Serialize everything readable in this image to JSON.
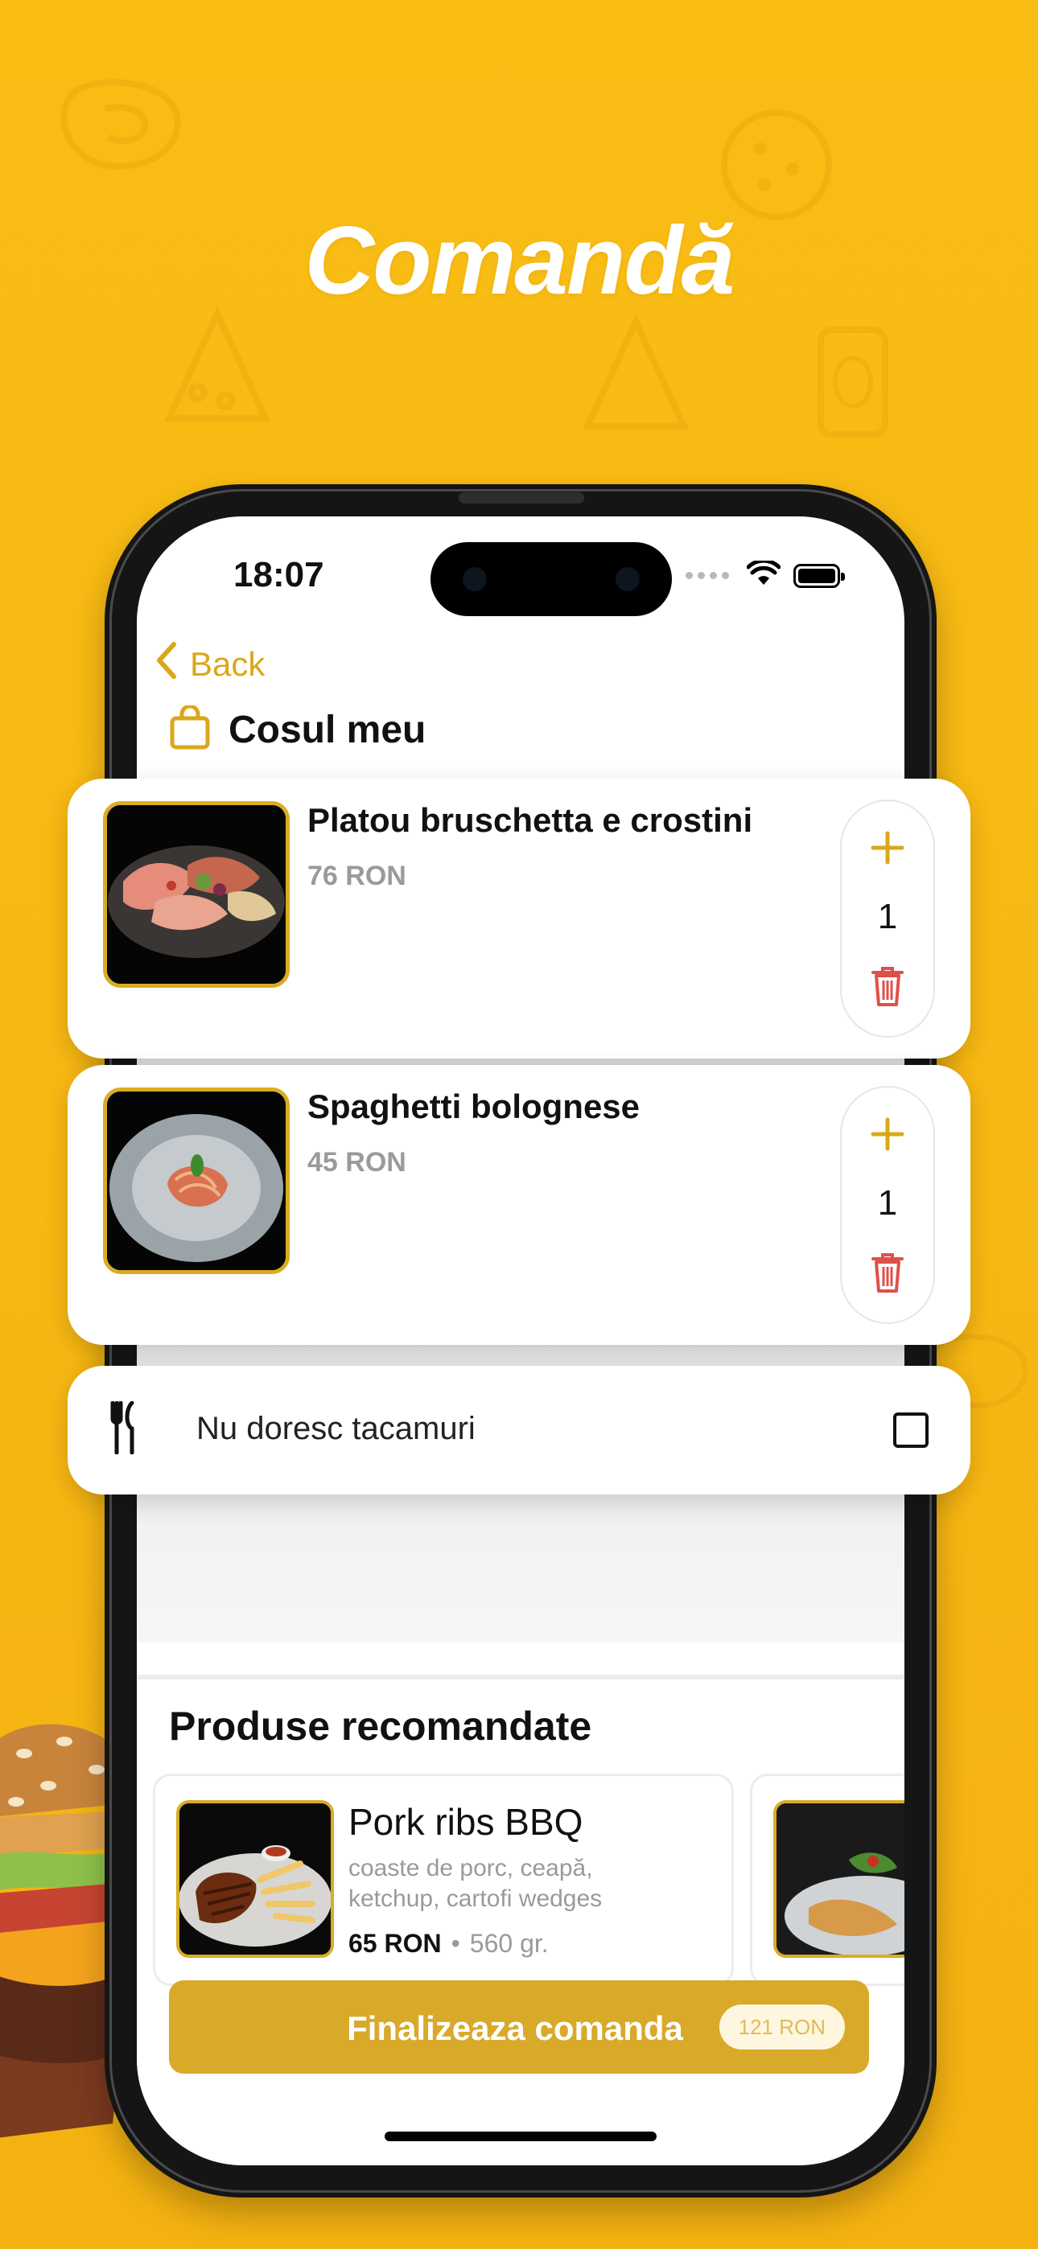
{
  "headline": "Comandă",
  "status_bar": {
    "time": "18:07"
  },
  "nav": {
    "back_label": "Back"
  },
  "cart": {
    "title": "Cosul meu"
  },
  "items": [
    {
      "name": "Platou bruschetta e crostini",
      "price": "76 RON",
      "quantity": "1"
    },
    {
      "name": "Spaghetti bolognese",
      "price": "45 RON",
      "quantity": "1"
    }
  ],
  "cutlery": {
    "label": "Nu doresc tacamuri",
    "checked": false
  },
  "recommended": {
    "title": "Produse recomandate",
    "products": [
      {
        "name": "Pork ribs BBQ",
        "description": "coaste de porc, ceapă, ketchup, cartofi wedges",
        "price": "65 RON",
        "separator": "•",
        "weight": "560 gr."
      }
    ]
  },
  "checkout": {
    "label": "Finalizeaza comanda",
    "total": "121 RON"
  },
  "colors": {
    "background": "#f7b813",
    "accent": "#d9a92a",
    "delete": "#e0504a",
    "price_gray": "#9a9a9a"
  },
  "icons": [
    "chevron-left-icon",
    "shopping-bag-icon",
    "plus-icon",
    "trash-icon",
    "cutlery-icon",
    "checkbox-icon",
    "wifi-icon",
    "battery-icon"
  ]
}
